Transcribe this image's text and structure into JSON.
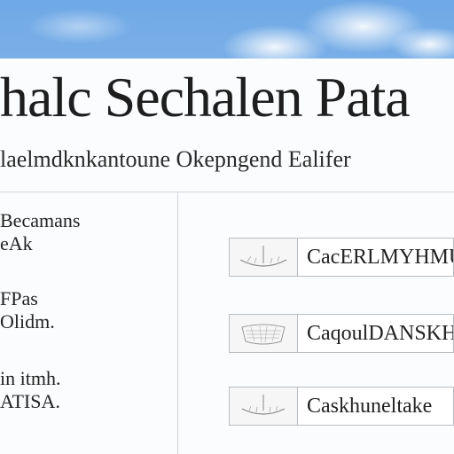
{
  "title": "halc Sechalen Pata",
  "subtitle": "laelmdknkantoune Okepngend Ealifer",
  "left_items": [
    {
      "line1": "Becamans",
      "line2": "eAk"
    },
    {
      "line1": "FPas",
      "line2": "Olidm."
    },
    {
      "line1": "in itmh.",
      "line2": "ATISA."
    }
  ],
  "rows": [
    {
      "label": "CacERLMYHMUD",
      "icon": "boat-sketch-icon"
    },
    {
      "label": "CaqoulDANSKH",
      "icon": "basket-sketch-icon"
    },
    {
      "label": "Caskhuneltake",
      "icon": "boat-sketch-icon"
    }
  ]
}
